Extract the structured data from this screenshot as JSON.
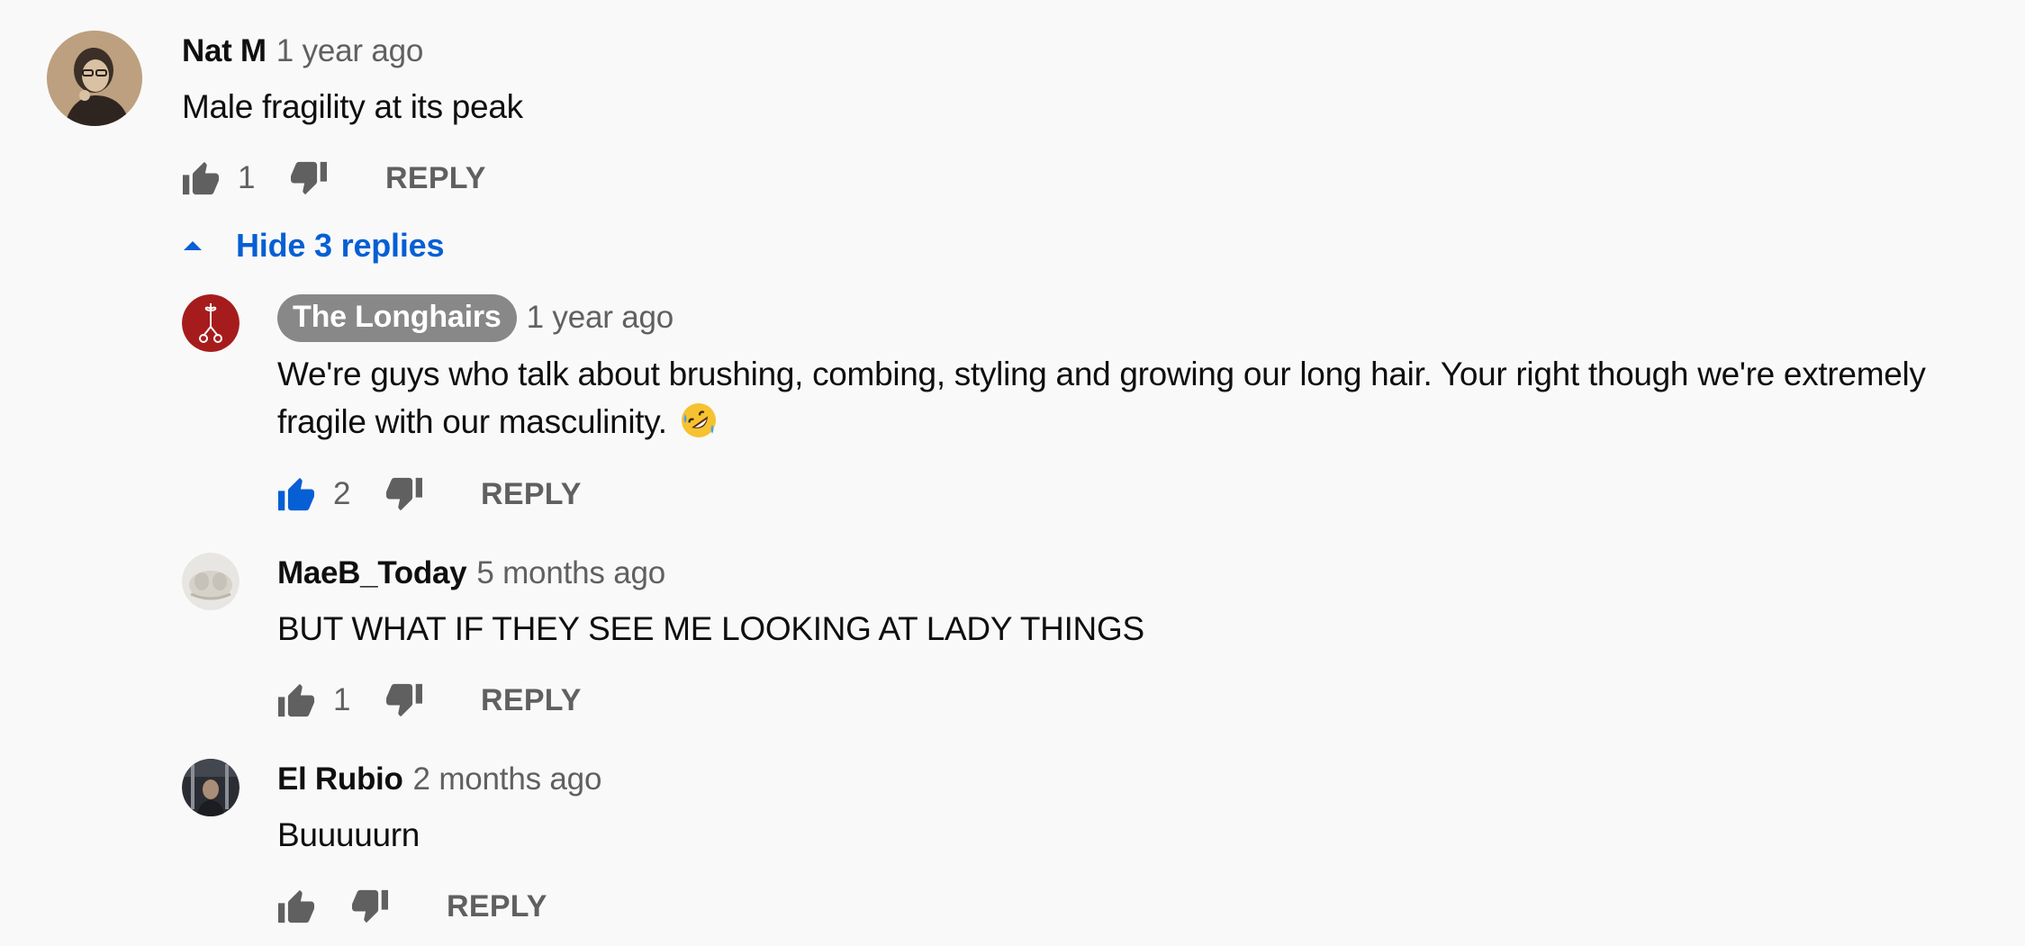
{
  "thread": {
    "top_comment": {
      "author": "Nat M",
      "time": "1 year ago",
      "text": "Male fragility at its peak",
      "like_count": "1",
      "reply_label": "REPLY",
      "avatar_icon": "user-photo-avatar"
    },
    "toggle_replies_label": "Hide 3 replies",
    "replies": [
      {
        "author": "The Longhairs",
        "author_is_creator": true,
        "time": "1 year ago",
        "text": "We're guys who talk about brushing, combing, styling and growing our long hair. Your right though we're extremely fragile with our masculinity.",
        "emoji": "rolling-on-floor-laughing-emoji",
        "like_count": "2",
        "liked": true,
        "reply_label": "REPLY",
        "avatar_icon": "channel-logo-avatar"
      },
      {
        "author": "MaeB_Today",
        "time": "5 months ago",
        "text": "BUT WHAT IF THEY SEE ME LOOKING AT LADY THINGS",
        "like_count": "1",
        "reply_label": "REPLY",
        "avatar_icon": "user-photo-avatar"
      },
      {
        "author": "El Rubio",
        "time": "2 months ago",
        "text": "Buuuuurn",
        "like_count": "",
        "reply_label": "REPLY",
        "avatar_icon": "user-photo-avatar"
      }
    ]
  },
  "colors": {
    "background": "#f9f9f9",
    "text_primary": "#0f0f0f",
    "text_secondary": "#606060",
    "link_blue": "#065fd4",
    "creator_badge": "#888888"
  }
}
